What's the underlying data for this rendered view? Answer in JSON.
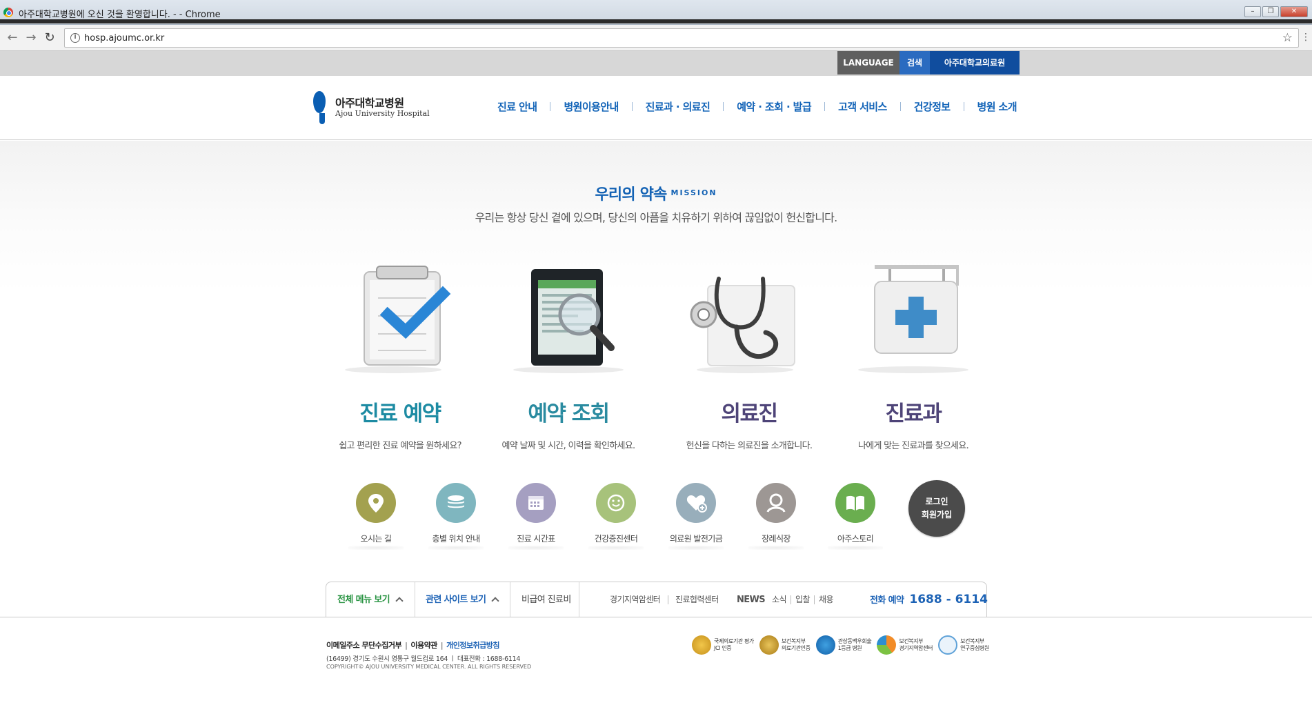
{
  "window": {
    "title": "아주대학교병원에 오신 것을 환영합니다. - - Chrome",
    "controls": [
      "minimize",
      "restore",
      "close"
    ]
  },
  "browser": {
    "url": "hosp.ajoumc.or.kr"
  },
  "topbar": {
    "language": "LANGUAGE",
    "search": "검색",
    "ajou": "아주대학교의료원"
  },
  "logo": {
    "ko": "아주대학교병원",
    "en": "Ajou University Hospital"
  },
  "gnb": [
    "진료 안내",
    "병원이용안내",
    "진료과 · 의료진",
    "예약 · 조회 · 발급",
    "고객 서비스",
    "건강정보",
    "병원 소개"
  ],
  "mission": {
    "title": "우리의 약속",
    "badge": "MISSION",
    "subtitle": "우리는 항상 당신 곁에 있으며, 당신의 아픔을 치유하기 위하여 끊임없이 헌신합니다."
  },
  "features": [
    {
      "title": "진료 예약",
      "desc": "쉽고 편리한 진료 예약을 원하세요?",
      "icon": "clipboard-check-icon"
    },
    {
      "title": "예약 조회",
      "desc": "예약 날짜 및 시간, 이력을 확인하세요.",
      "icon": "tablet-magnifier-icon"
    },
    {
      "title": "의료진",
      "desc": "헌신을 다하는 의료진을 소개합니다.",
      "icon": "stethoscope-icon"
    },
    {
      "title": "진료과",
      "desc": "나에게 맞는 진료과를 찾으세요.",
      "icon": "hospital-sign-icon"
    }
  ],
  "quick_links": [
    {
      "label": "오시는 길",
      "icon": "map-pin-icon",
      "color": "#a3a14f"
    },
    {
      "label": "층별 위치 안내",
      "icon": "layers-icon",
      "color": "#7fb6bf"
    },
    {
      "label": "진료 시간표",
      "icon": "calendar-icon",
      "color": "#a59fc1"
    },
    {
      "label": "건강증진센터",
      "icon": "smile-icon",
      "color": "#a7c27b"
    },
    {
      "label": "의료원 발전기금",
      "icon": "heart-plus-icon",
      "color": "#98aebb"
    },
    {
      "label": "장례식장",
      "icon": "person-icon",
      "color": "#9d9794"
    },
    {
      "label": "아주스토리",
      "icon": "book-icon",
      "color": "#6aae4f"
    }
  ],
  "login": {
    "line1": "로그인",
    "line2": "회원가입"
  },
  "bottom_bar": {
    "all_menu": "전체 메뉴 보기",
    "related_sites": "관련 사이트 보기",
    "non_covered": "비급여 진료비",
    "links": [
      "경기지역암센터",
      "진료협력센터"
    ],
    "news": "NEWS",
    "news_links": [
      "소식",
      "입찰",
      "채용"
    ],
    "phone_label": "전화 예약",
    "phone_number": "1688 - 6114"
  },
  "footer": {
    "links": [
      "이메일주소 무단수집거부",
      "이용약관",
      "개인정보취급방침"
    ],
    "address": "(16499) 경기도 수원시 영통구 월드컵로 164  ㅣ  대표전화 : 1688-6114",
    "copyright": "COPYRIGHT© AJOU UNIVERSITY MEDICAL CENTER. ALL RIGHTS RESERVED",
    "certs": [
      {
        "line1": "국제의료기관 평가",
        "line2": "JCI 인증"
      },
      {
        "line1": "보건복지부",
        "line2": "의료기관인증"
      },
      {
        "line1": "관상동맥우회술",
        "line2": "1등급 병원"
      },
      {
        "line1": "보건복지부",
        "line2": "경기지역암센터"
      },
      {
        "line1": "보건복지부",
        "line2": "연구중심병원"
      }
    ]
  },
  "colors": {
    "brand_blue": "#1364b8",
    "teal_title": "#1d8ba3",
    "purple_title": "#4e4478",
    "topbar_gray": "#d7d7d7"
  }
}
